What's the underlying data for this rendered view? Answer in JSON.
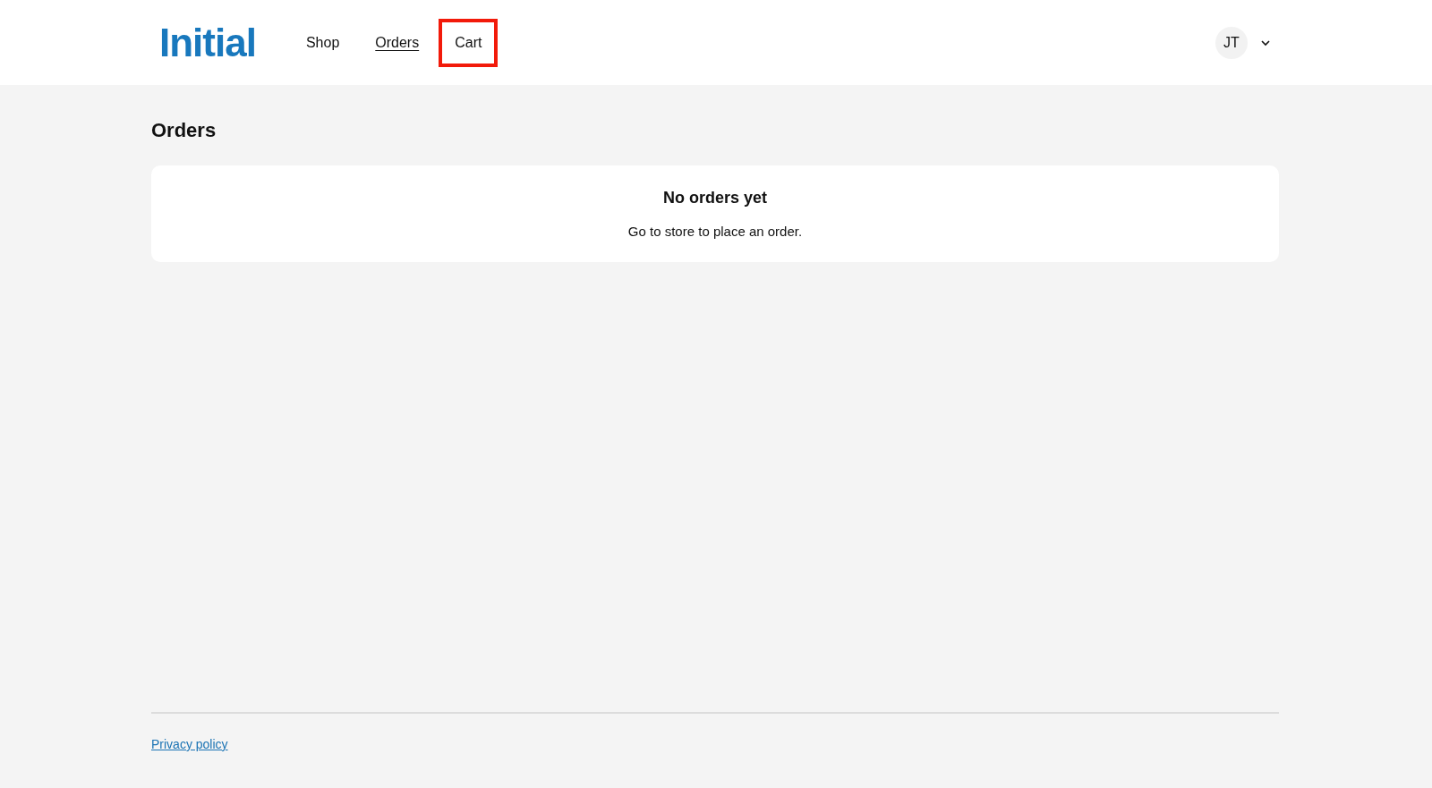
{
  "header": {
    "logo": "Initial",
    "nav": [
      {
        "label": "Shop",
        "selected": false,
        "highlighted": false
      },
      {
        "label": "Orders",
        "selected": true,
        "highlighted": false
      },
      {
        "label": "Cart",
        "selected": false,
        "highlighted": true
      }
    ],
    "user": {
      "initials": "JT"
    }
  },
  "page": {
    "title": "Orders",
    "empty_state": {
      "title": "No orders yet",
      "message": "Go to store to place an order."
    }
  },
  "footer": {
    "links": [
      "Privacy policy"
    ]
  }
}
